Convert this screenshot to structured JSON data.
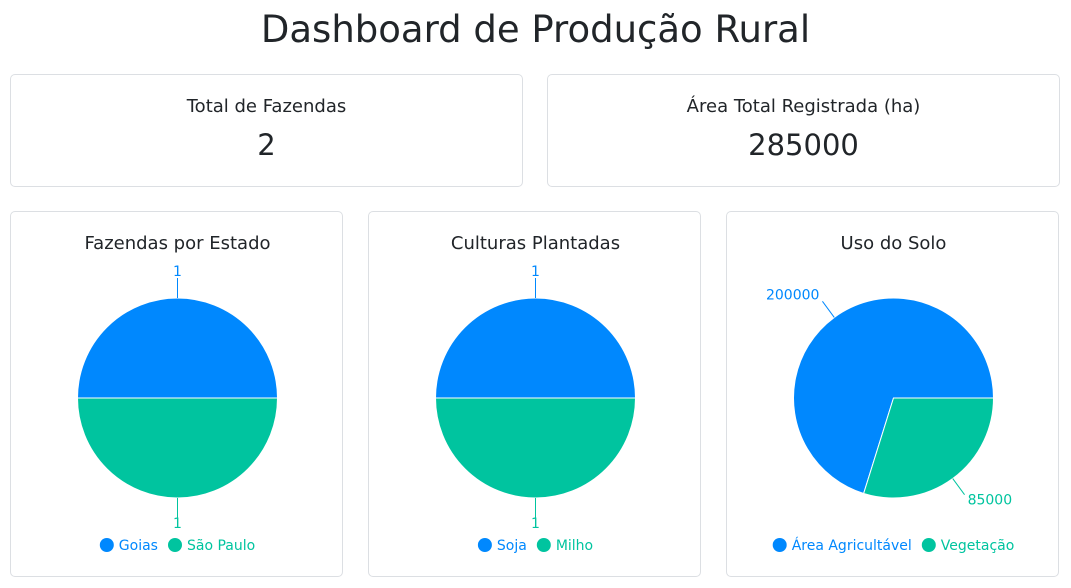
{
  "title": "Dashboard de Produção Rural",
  "stats": [
    {
      "label": "Total de Fazendas",
      "value": "2"
    },
    {
      "label": "Área Total Registrada (ha)",
      "value": "285000"
    }
  ],
  "colors": {
    "blue": "#0088fe",
    "green": "#00c49f"
  },
  "chart_data": [
    {
      "type": "pie",
      "title": "Fazendas por Estado",
      "categories": [
        "Goias",
        "São Paulo"
      ],
      "values": [
        1,
        1
      ],
      "data_labels": [
        "1",
        "1"
      ],
      "legend": "bottom"
    },
    {
      "type": "pie",
      "title": "Culturas Plantadas",
      "categories": [
        "Soja",
        "Milho"
      ],
      "values": [
        1,
        1
      ],
      "data_labels": [
        "1",
        "1"
      ],
      "legend": "bottom"
    },
    {
      "type": "pie",
      "title": "Uso do Solo",
      "categories": [
        "Área Agricultável",
        "Vegetação"
      ],
      "values": [
        200000,
        85000
      ],
      "data_labels": [
        "200000",
        "85000"
      ],
      "legend": "bottom"
    }
  ]
}
